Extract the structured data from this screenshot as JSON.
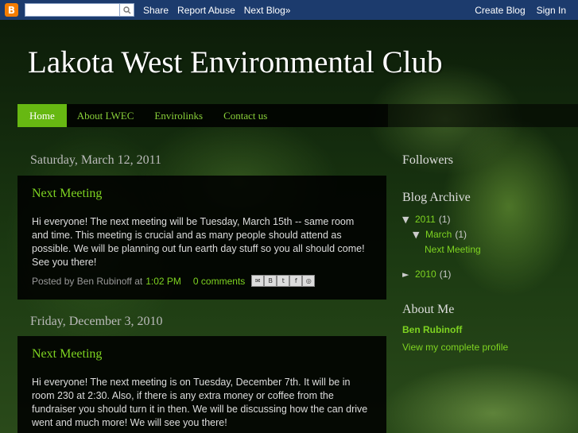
{
  "navbar": {
    "logo": "B",
    "share": "Share",
    "report": "Report Abuse",
    "next_blog": "Next Blog»",
    "create_blog": "Create Blog",
    "sign_in": "Sign In"
  },
  "header": {
    "title": "Lakota West Environmental Club"
  },
  "tabs": [
    "Home",
    "About LWEC",
    "Envirolinks",
    "Contact us"
  ],
  "posts": [
    {
      "date": "Saturday, March 12, 2011",
      "title": "Next Meeting",
      "body": "Hi everyone! The next meeting will be Tuesday, March 15th -- same room and time. This meeting is crucial and as many people should attend as possible. We will be planning out fun earth day stuff so you all should come! See you there!",
      "posted_by": "Posted by Ben Rubinoff at",
      "time": "1:02 PM",
      "comments": "0 comments"
    },
    {
      "date": "Friday, December 3, 2010",
      "title": "Next Meeting",
      "body": "Hi everyone! The next meeting is on Tuesday, December 7th. It will be in room 230 at 2:30. Also, if there is any extra money or coffee from the fundraiser you should turn it in then. We will be discussing how the can drive went and much more! We will see you there!"
    }
  ],
  "sidebar": {
    "followers": "Followers",
    "archive_title": "Blog Archive",
    "archive": {
      "y2011": {
        "toggle": "▼",
        "label": "2011",
        "count": "(1)"
      },
      "march": {
        "toggle": "▼",
        "label": "March",
        "count": "(1)"
      },
      "post": "Next Meeting",
      "y2010": {
        "toggle": "►",
        "label": "2010",
        "count": "(1)"
      }
    },
    "about_title": "About Me",
    "about_name": "Ben Rubinoff",
    "about_profile": "View my complete profile"
  },
  "icons": [
    "blogger-logo-icon",
    "search-icon",
    "email-icon",
    "blogthis-icon",
    "twitter-icon",
    "facebook-icon",
    "buzz-icon"
  ]
}
